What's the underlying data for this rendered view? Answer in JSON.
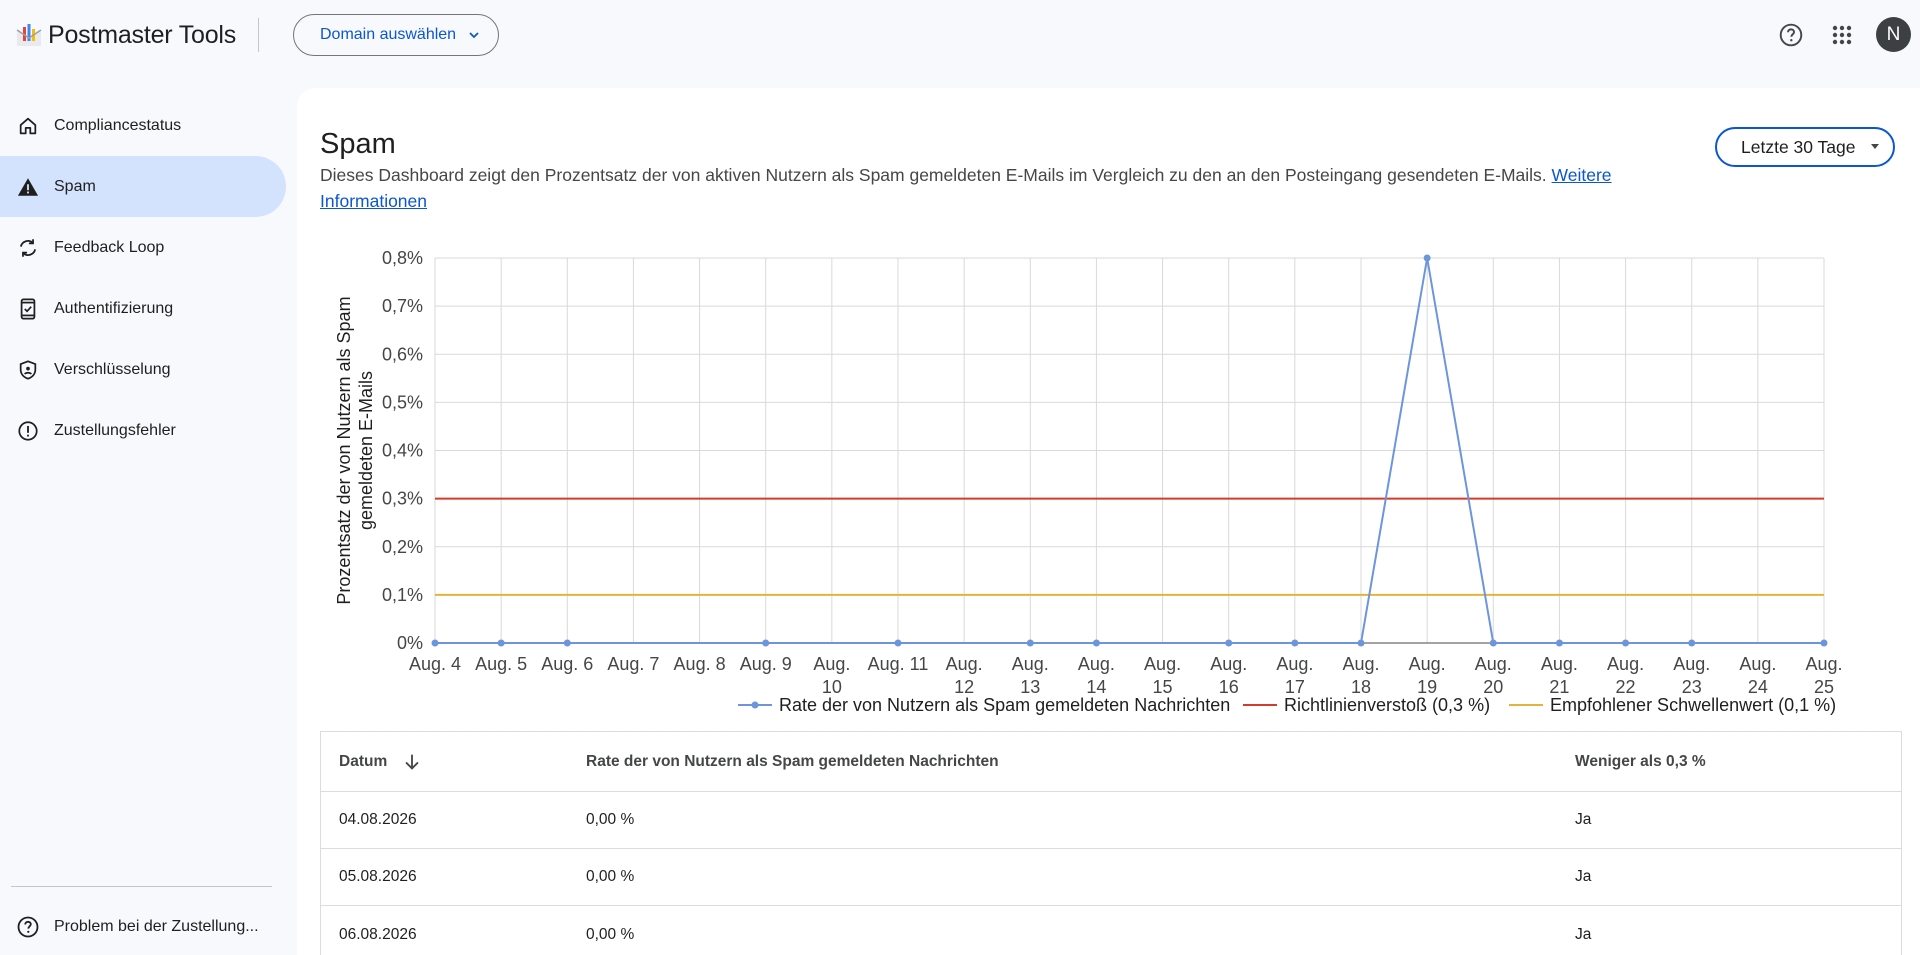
{
  "app": {
    "title": "Postmaster Tools",
    "avatar_letter": "N"
  },
  "header": {
    "domain_button": "Domain auswählen"
  },
  "sidebar": {
    "items": [
      {
        "label": "Compliancestatus",
        "icon": "home-icon"
      },
      {
        "label": "Spam",
        "icon": "warning-icon",
        "active": true
      },
      {
        "label": "Feedback Loop",
        "icon": "refresh-icon"
      },
      {
        "label": "Authentifizierung",
        "icon": "phone-check-icon"
      },
      {
        "label": "Verschlüsselung",
        "icon": "shield-icon"
      },
      {
        "label": "Zustellungsfehler",
        "icon": "error-icon"
      }
    ],
    "bottom_item": "Problem bei der Zustellung..."
  },
  "page": {
    "title": "Spam",
    "description": "Dieses Dashboard zeigt den Prozentsatz der von aktiven Nutzern als Spam gemeldeten E-Mails im Vergleich zu den an den Posteingang gesendeten E-Mails.",
    "link": "Weitere Informationen",
    "range": "Letzte 30 Tage"
  },
  "colors": {
    "series": "#6d95dc",
    "policy": "#d33b2c",
    "threshold": "#e3b43c",
    "accent": "#0b57d0",
    "active_nav": "#d3e3fd"
  },
  "chart_data": {
    "type": "line",
    "ylabel_lines": [
      "Prozentsatz der von Nutzern als Spam",
      "gemeldeten E-Mails"
    ],
    "ylim": [
      0,
      0.8
    ],
    "yticks": [
      "0%",
      "0,1%",
      "0,2%",
      "0,3%",
      "0,4%",
      "0,5%",
      "0,6%",
      "0,7%",
      "0,8%"
    ],
    "categories": [
      [
        "Aug. 4"
      ],
      [
        "Aug. 5"
      ],
      [
        "Aug. 6"
      ],
      [
        "Aug. 7"
      ],
      [
        "Aug. 8"
      ],
      [
        "Aug. 9"
      ],
      [
        "Aug.",
        "10"
      ],
      [
        "Aug. 11"
      ],
      [
        "Aug.",
        "12"
      ],
      [
        "Aug.",
        "13"
      ],
      [
        "Aug.",
        "14"
      ],
      [
        "Aug.",
        "15"
      ],
      [
        "Aug.",
        "16"
      ],
      [
        "Aug.",
        "17"
      ],
      [
        "Aug.",
        "18"
      ],
      [
        "Aug.",
        "19"
      ],
      [
        "Aug.",
        "20"
      ],
      [
        "Aug.",
        "21"
      ],
      [
        "Aug.",
        "22"
      ],
      [
        "Aug.",
        "23"
      ],
      [
        "Aug.",
        "24"
      ],
      [
        "Aug.",
        "25"
      ]
    ],
    "series": [
      {
        "name": "Rate der von Nutzern als Spam gemeldeten Nachrichten",
        "color": "#6d95dc",
        "values": [
          0,
          0,
          0,
          null,
          null,
          0,
          null,
          0,
          null,
          0,
          0,
          null,
          0,
          0,
          0,
          0.8,
          0,
          0,
          0,
          0,
          null,
          0
        ]
      },
      {
        "name": "Richtlinienverstoß (0,3 %)",
        "color": "#d33b2c",
        "constant": 0.3
      },
      {
        "name": "Empfohlener Schwellenwert (0,1 %)",
        "color": "#e3b43c",
        "constant": 0.1
      }
    ],
    "grid": true,
    "legend": "bottom"
  },
  "table": {
    "headers": [
      "Datum",
      "Rate der von Nutzern als Spam gemeldeten Nachrichten",
      "Weniger als 0,3 %"
    ],
    "rows": [
      [
        "04.08.2026",
        "0,00 %",
        "Ja"
      ],
      [
        "05.08.2026",
        "0,00 %",
        "Ja"
      ],
      [
        "06.08.2026",
        "0,00 %",
        "Ja"
      ]
    ]
  }
}
